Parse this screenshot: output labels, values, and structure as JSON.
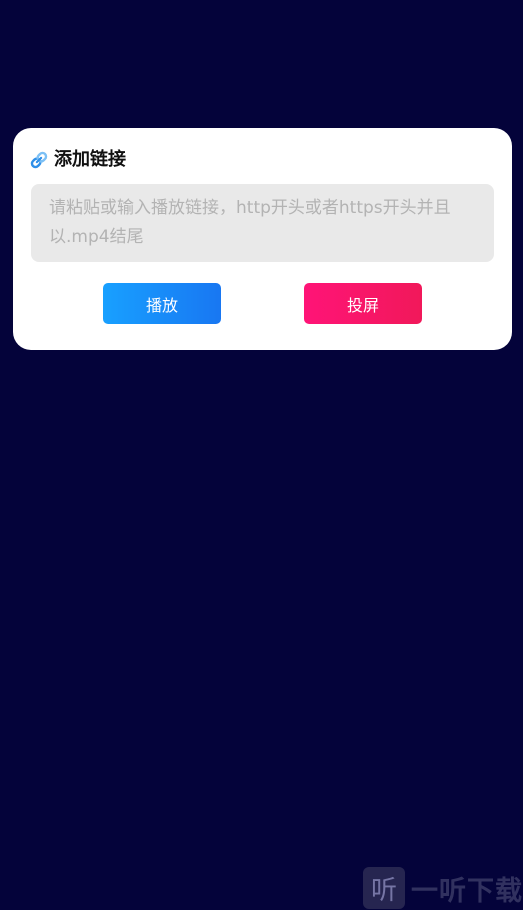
{
  "dialog": {
    "title": "添加链接",
    "title_icon": "link-icon",
    "url_input": {
      "value": "",
      "placeholder": "请粘贴或输入播放链接，http开头或者https开头并且以.mp4结尾"
    },
    "play_button_label": "播放",
    "cast_button_label": "投屏"
  },
  "watermark": {
    "logo_glyph": "听",
    "text": "一听下载"
  },
  "colors": {
    "background": "#04033a",
    "dialog_bg": "#ffffff",
    "input_bg": "#e9e9e9",
    "play_button": "#1a8cff",
    "cast_button": "#ff1466"
  }
}
